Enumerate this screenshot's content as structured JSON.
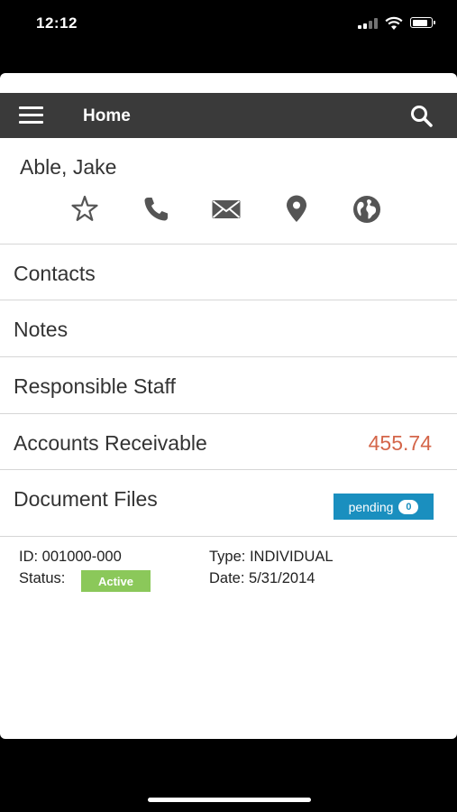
{
  "status_bar": {
    "time": "12:12",
    "battery_level": 0.85
  },
  "header": {
    "title": "Home",
    "menu_icon": "hamburger-menu-icon",
    "search_icon": "search-icon"
  },
  "client": {
    "name": "Able, Jake",
    "actions": [
      "star-icon",
      "phone-icon",
      "email-icon",
      "location-pin-icon",
      "globe-icon"
    ]
  },
  "menu": {
    "contacts": "Contacts",
    "notes": "Notes",
    "responsible_staff": "Responsible Staff",
    "accounts_receivable": "Accounts Receivable",
    "accounts_receivable_value": "455.74",
    "document_files": "Document Files",
    "pending_label": "pending",
    "pending_count": "0"
  },
  "details": {
    "id": "ID: 001000-000",
    "status_label": "Status:",
    "status_value": "Active",
    "type": "Type: INDIVIDUAL",
    "date": "Date: 5/31/2014"
  },
  "colors": {
    "header_bg": "#3a3a3a",
    "amount": "#d4664a",
    "pending_badge": "#1a8fbf",
    "active_badge": "#8bc85a"
  }
}
